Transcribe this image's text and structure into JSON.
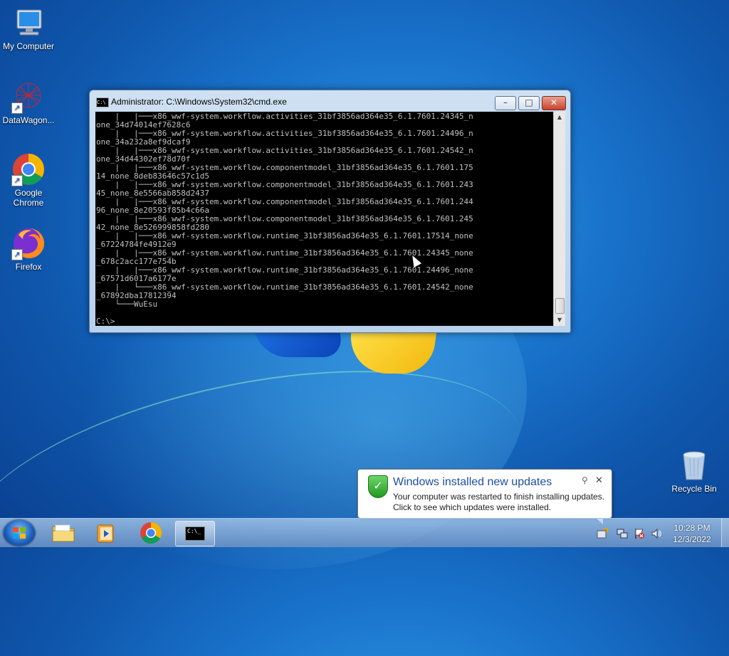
{
  "desktop": {
    "icons": [
      {
        "label": "My Computer",
        "icon": "computer-icon"
      },
      {
        "label": "DataWagon...",
        "icon": "datawagon-icon"
      },
      {
        "label": "Google Chrome",
        "icon": "chrome-icon"
      },
      {
        "label": "Firefox",
        "icon": "firefox-icon"
      },
      {
        "label": "Recycle Bin",
        "icon": "recycle-bin-icon"
      }
    ]
  },
  "cmd": {
    "title": "Administrator: C:\\Windows\\System32\\cmd.exe",
    "title_icon_text": "C:\\",
    "buttons": {
      "minimize": "–",
      "maximize": "□",
      "close": "✕"
    },
    "lines": [
      "    |   |───x86_wwf-system.workflow.activities_31bf3856ad364e35_6.1.7601.24345_n",
      "one_34d74014ef7628c6",
      "    |   |───x86_wwf-system.workflow.activities_31bf3856ad364e35_6.1.7601.24496_n",
      "one_34a232a8ef9dcaf9",
      "    |   |───x86_wwf-system.workflow.activities_31bf3856ad364e35_6.1.7601.24542_n",
      "one_34d44302ef78d70f",
      "    |   |───x86_wwf-system.workflow.componentmodel_31bf3856ad364e35_6.1.7601.175",
      "14_none_8deb83646c57c1d5",
      "    |   |───x86_wwf-system.workflow.componentmodel_31bf3856ad364e35_6.1.7601.243",
      "45_none_8e5566ab858d2437",
      "    |   |───x86_wwf-system.workflow.componentmodel_31bf3856ad364e35_6.1.7601.244",
      "96_none_8e20593f85b4c66a",
      "    |   |───x86_wwf-system.workflow.componentmodel_31bf3856ad364e35_6.1.7601.245",
      "42_none_8e526999858fd280",
      "    |   |───x86_wwf-system.workflow.runtime_31bf3856ad364e35_6.1.7601.17514_none",
      "_67224784fe4912e9",
      "    |   |───x86_wwf-system.workflow.runtime_31bf3856ad364e35_6.1.7601.24345_none",
      "_678c2acc177e754b",
      "    |   |───x86_wwf-system.workflow.runtime_31bf3856ad364e35_6.1.7601.24496_none",
      "_67571d6017a6177e",
      "    |   └───x86_wwf-system.workflow.runtime_31bf3856ad364e35_6.1.7601.24542_none",
      "_67892dba17812394",
      "    └───WuEsu",
      "",
      "C:\\>"
    ]
  },
  "notification": {
    "title": "Windows installed new updates",
    "line1": "Your computer was restarted to finish installing updates.",
    "line2": "Click to see which updates were installed.",
    "close": "✕",
    "icon": "shield-check-icon"
  },
  "taskbar": {
    "items": [
      "start-button",
      "explorer-icon",
      "media-player-icon",
      "chrome-icon",
      "cmd-icon"
    ],
    "cmd_icon_text": "C:\\_",
    "time": "10:28 PM",
    "date": "12/3/2022"
  }
}
